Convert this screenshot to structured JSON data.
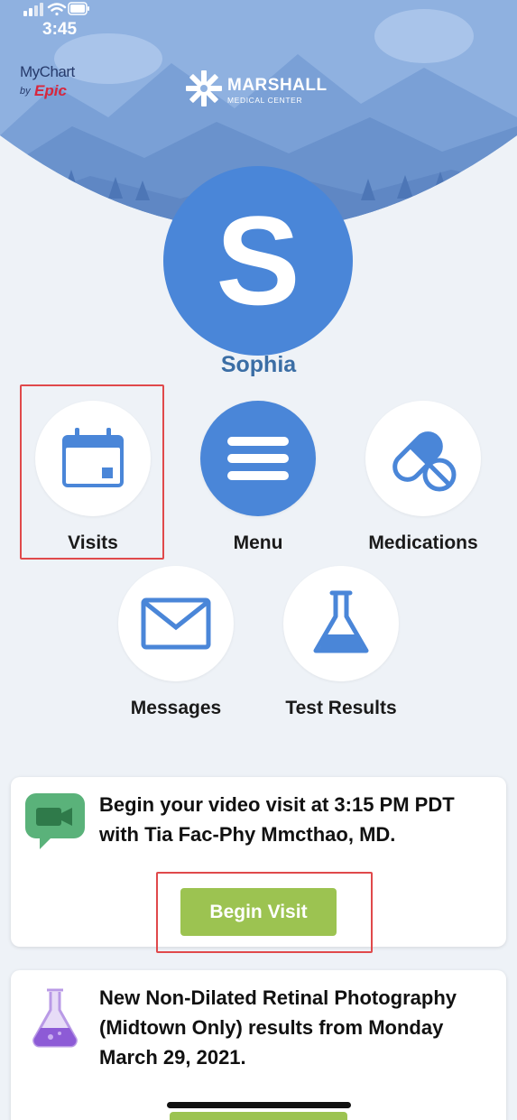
{
  "status_bar": {
    "time": "3:45"
  },
  "header": {
    "mychart_logo": {
      "text": "MyChart",
      "by": "by",
      "brand": "Epic"
    },
    "org_logo": {
      "name": "MARSHALL",
      "subtitle": "MEDICAL CENTER"
    }
  },
  "profile": {
    "initial": "S",
    "name": "Sophia"
  },
  "quick_actions": [
    {
      "label": "Visits",
      "icon": "calendar-icon"
    },
    {
      "label": "Menu",
      "icon": "menu-icon"
    },
    {
      "label": "Medications",
      "icon": "pill-icon"
    },
    {
      "label": "Messages",
      "icon": "envelope-icon"
    },
    {
      "label": "Test Results",
      "icon": "flask-icon"
    }
  ],
  "cards": [
    {
      "icon": "video-chat-icon",
      "text": "Begin your video visit at 3:15 PM PDT with Tia Fac-Phy Mmcthao, MD.",
      "button_label": "Begin Visit"
    },
    {
      "icon": "flask-icon",
      "text": "New Non-Dilated Retinal Photography (Midtown Only) results from Monday March 29, 2021."
    }
  ],
  "colors": {
    "accent": "#4a86d8",
    "button": "#9cc351",
    "highlight": "#e0494b",
    "background": "#eef2f7"
  }
}
